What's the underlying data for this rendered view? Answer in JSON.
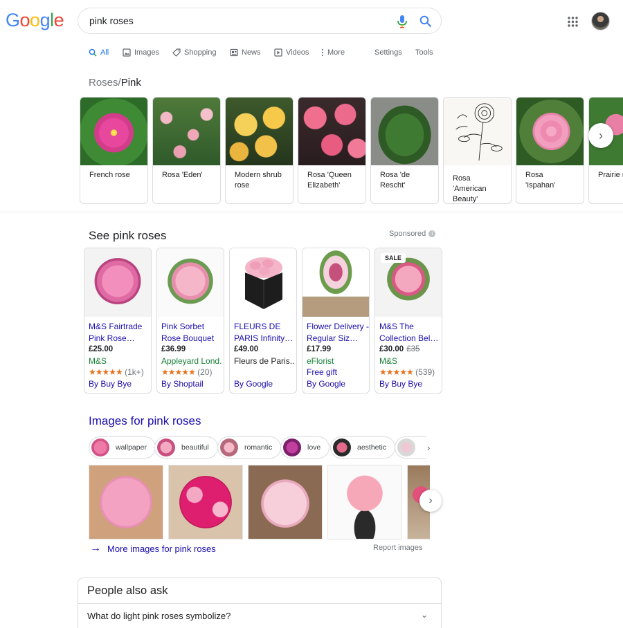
{
  "logo": {
    "letters": [
      "G",
      "o",
      "o",
      "g",
      "l",
      "e"
    ],
    "colors": [
      "#4285f4",
      "#ea4335",
      "#fbbc05",
      "#4285f4",
      "#34a853",
      "#ea4335"
    ]
  },
  "search": {
    "query": "pink roses"
  },
  "tabs": [
    {
      "label": "All",
      "icon": "search-icon",
      "active": true
    },
    {
      "label": "Images",
      "icon": "image-icon"
    },
    {
      "label": "Shopping",
      "icon": "tag-icon"
    },
    {
      "label": "News",
      "icon": "news-icon"
    },
    {
      "label": "Videos",
      "icon": "video-icon"
    },
    {
      "label": "More",
      "icon": "more-vert-icon"
    },
    {
      "label": "Settings"
    },
    {
      "label": "Tools"
    }
  ],
  "knowledge": {
    "breadcrumb_parent": "Roses",
    "separator": "/",
    "breadcrumb_current": "Pink",
    "cards": [
      "French rose",
      "Rosa 'Eden'",
      "Modern shrub rose",
      "Rosa 'Queen Elizabeth'",
      "Rosa 'de Rescht'",
      "Rosa 'American Beauty'",
      "Rosa 'Ispahan'",
      "Prairie r"
    ]
  },
  "shopping": {
    "title": "See pink roses",
    "sponsored": "Sponsored",
    "products": [
      {
        "name": "M&S Fairtrade Pink Rose…",
        "price": "£25.00",
        "old_price": "",
        "store": "M&S",
        "stars": "★★★★★",
        "rating_count": "(1k+)",
        "by": "By Buy Bye",
        "sale": ""
      },
      {
        "name": "Pink Sorbet Rose Bouquet",
        "price": "£36.99",
        "old_price": "",
        "store": "Appleyard Lond.",
        "stars": "★★★★★",
        "rating_count": "(20)",
        "by": "By Shoptail",
        "sale": ""
      },
      {
        "name": "FLEURS DE PARIS Infinity…",
        "price": "£49.00",
        "old_price": "",
        "store": "Fleurs de Paris..",
        "stars": "",
        "rating_count": "",
        "by": "By Google",
        "sale": ""
      },
      {
        "name": "Flower Delivery - Regular Siz…",
        "price": "£17.99",
        "old_price": "",
        "store": "eFlorist",
        "stars": "",
        "rating_count": "",
        "extra": "Free gift",
        "by": "By Google",
        "sale": ""
      },
      {
        "name": "M&S The Collection Bel…",
        "price": "£30.00",
        "old_price": "£35",
        "store": "M&S",
        "stars": "★★★★★",
        "rating_count": "(539)",
        "by": "By Buy Bye",
        "sale": "SALE"
      }
    ]
  },
  "images": {
    "title": "Images for pink roses",
    "chips": [
      "wallpaper",
      "beautiful",
      "romantic",
      "love",
      "aesthetic"
    ],
    "more_link": "More images for pink roses",
    "report": "Report images"
  },
  "paa": {
    "title": "People also ask",
    "questions": [
      "What do light pink roses symbolize?"
    ]
  }
}
